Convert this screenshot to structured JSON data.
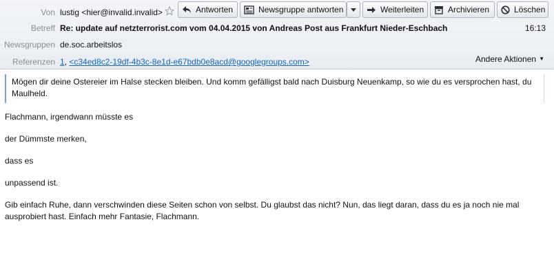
{
  "header": {
    "from_label": "Von",
    "from_value": "lustig <hier@invalid.invalid>",
    "subject_label": "Betreff",
    "subject_value": "Re: update auf netzterrorist.com vom 04.04.2015 von Andreas Post aus Frankfurt Nieder-Eschbach",
    "time": "16:13",
    "newsgroups_label": "Newsgruppen",
    "newsgroups_value": "de.soc.arbeitslos",
    "references_label": "Referenzen",
    "reference_1": "1",
    "reference_separator": ",",
    "reference_2": "<c34ed8c2-19df-4b3c-8e1d-e67bdb0e8acd@googlegroups.com>",
    "other_actions": "Andere Aktionen"
  },
  "toolbar": {
    "reply": "Antworten",
    "reply_newsgroup": "Newsgruppe antworten",
    "forward": "Weiterleiten",
    "archive": "Archivieren",
    "delete": "Löschen"
  },
  "body": {
    "quote": "Mögen dir deine Ostereier im Halse stecken bleiben. Und komm gefälligst bald nach Duisburg Neuenkamp, so wie du es versprochen hast, du Maulheld.",
    "line1": "Flachmann, irgendwann müsste es",
    "line2": "der Dümmste merken,",
    "line3": "dass es",
    "line4": "unpassend ist.",
    "paragraph": "Gib einfach Ruhe, dann verschwinden diese Seiten schon von selbst. Du glaubst das nicht? Nun, das liegt daran, dass du es ja noch nie mal ausprobiert hast. Einfach mehr Fantasie, Flachmann."
  },
  "colors": {
    "link": "#1565c0",
    "header_bg": "#eceff3",
    "quote_bar": "#7a9fd4"
  }
}
